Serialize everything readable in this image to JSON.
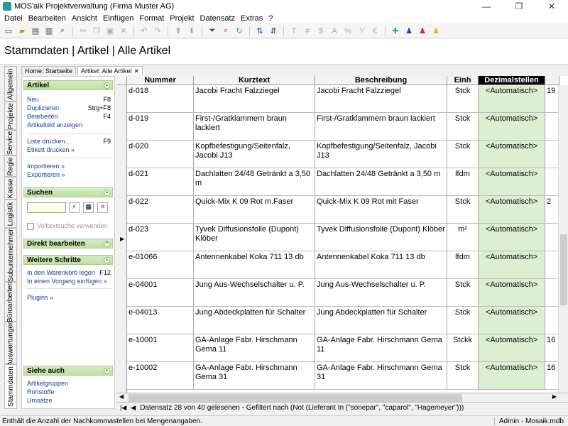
{
  "window": {
    "title": "MOS'aik Projektverwaltung (Firma Muster AG)"
  },
  "menu": [
    "Datei",
    "Bearbeiten",
    "Ansicht",
    "Einfügen",
    "Format",
    "Projekt",
    "Datensatz",
    "Extras",
    "?"
  ],
  "page_title": "Stammdaten | Artikel | Alle Artikel",
  "doc_tabs": [
    {
      "label": "Home: Startseite"
    },
    {
      "label": "Artikel: Alle Artikel"
    }
  ],
  "vtabs": [
    "Allgemein",
    "Projekte",
    "Service",
    "Regie",
    "Kasse",
    "Logistik",
    "Subunternehmer",
    "Büroarbeiten",
    "Auswertungen",
    "Stammdaten"
  ],
  "sidepanel": {
    "artikel": {
      "title": "Artikel",
      "items": [
        {
          "label": "Neu",
          "shortcut": "F8"
        },
        {
          "label": "Duplizieren",
          "shortcut": "Strg+F8"
        },
        {
          "label": "Bearbeiten",
          "shortcut": "F4"
        },
        {
          "label": "Artikelbild anzeigen",
          "shortcut": ""
        },
        {
          "label": "Liste drucken...",
          "shortcut": "F9"
        },
        {
          "label": "Etikett drucken »",
          "shortcut": ""
        },
        {
          "label": "Importieren »",
          "shortcut": ""
        },
        {
          "label": "Exportieren »",
          "shortcut": ""
        }
      ]
    },
    "suchen": {
      "title": "Suchen",
      "fulltext_label": "Volltextsuche verwenden",
      "search_value": ""
    },
    "direkt": {
      "title": "Direkt bearbeiten"
    },
    "weitere": {
      "title": "Weitere Schritte",
      "items": [
        {
          "label": "In den Warenkorb legen",
          "shortcut": "F12"
        },
        {
          "label": "In einen Vorgang einfügen »",
          "shortcut": ""
        },
        {
          "label": "Plugins »",
          "shortcut": ""
        }
      ]
    },
    "siehe": {
      "title": "Siehe auch",
      "items": [
        "Artikelgruppen",
        "Rohstoffe",
        "Umsätze"
      ]
    }
  },
  "grid": {
    "columns": [
      "Nummer",
      "Kurztext",
      "Beschreibung",
      "Einh",
      "Dezimalstellen"
    ],
    "rows": [
      {
        "nummer": "d-018",
        "kurz": "Jacobi Fracht Falzziegel",
        "beschr": "Jacobi Fracht Falzziegel",
        "einh": "Stck",
        "dez": "<Automatisch>",
        "extra": "19"
      },
      {
        "nummer": "d-019",
        "kurz": "First-/Gratklammern braun lackiert",
        "beschr": "First-/Gratklammern braun lackiert",
        "einh": "Stck",
        "dez": "<Automatisch>",
        "extra": ""
      },
      {
        "nummer": "d-020",
        "kurz": "Kopfbefestigung/Seitenfalz, Jacobi J13",
        "beschr": "Kopfbefestigung/Seitenfalz, Jacobi J13",
        "einh": "Stck",
        "dez": "<Automatisch>",
        "extra": ""
      },
      {
        "nummer": "d-021",
        "kurz": "Dachlatten 24/48 Getränkt a 3,50 m",
        "beschr": "Dachlatten 24/48 Getränkt a 3,50 m",
        "einh": "lfdm",
        "dez": "<Automatisch>",
        "extra": ""
      },
      {
        "nummer": "d-022",
        "kurz": "Quick-Mix K 09 Rot m.Faser",
        "beschr": "Quick-Mix K 09 Rot mit Faser",
        "einh": "Stck",
        "dez": "<Automatisch>",
        "extra": "2"
      },
      {
        "nummer": "d-023",
        "kurz": "Tyvek Diffusionsfolie (Dupont) Klöber",
        "beschr": "Tyvek Diffusionsfolie (Dupont) Klöber",
        "einh": "m²",
        "dez": "<Automatisch>",
        "extra": ""
      },
      {
        "nummer": "e-01066",
        "kurz": "Antennenkabel Koka 711 13 db",
        "beschr": "Antennenkabel Koka 711 13 db",
        "einh": "lfdm",
        "dez": "<Automatisch>",
        "extra": ""
      },
      {
        "nummer": "e-04001",
        "kurz": "Jung Aus-Wechselschalter u. P.",
        "beschr": "Jung Aus-Wechselschalter u. P.",
        "einh": "Stck",
        "dez": "<Automatisch>",
        "extra": ""
      },
      {
        "nummer": "e-04013",
        "kurz": "Jung Abdeckplatten für Schalter",
        "beschr": "Jung Abdeckplatten für Schalter",
        "einh": "Stck",
        "dez": "<Automatisch>",
        "extra": ""
      },
      {
        "nummer": "e-10001",
        "kurz": "GA-Anlage Fabr. Hirschmann Gema 11",
        "beschr": "GA-Anlage Fabr. Hirschmann Gema 11",
        "einh": "Stckk",
        "dez": "<Automatisch>",
        "extra": "16"
      },
      {
        "nummer": "e-10002",
        "kurz": "GA-Anlage Fabr. Hirschmann Gema 31",
        "beschr": "GA-Anlage Fabr. Hirschmann Gema 31",
        "einh": "Stck",
        "dez": "<Automatisch>",
        "extra": "16"
      }
    ]
  },
  "record_status": "Datensatz 28 von 40 gelesenen - Gefiltert nach (Not (Lieferant In (\"sonepar\", \"caparol\", \"Hagemeyer\")))",
  "statusbar": {
    "message": "Enthält die Anzahl der Nachkommastellen bei Mengenangaben.",
    "user": "Admin - Mosaik.mdb"
  }
}
